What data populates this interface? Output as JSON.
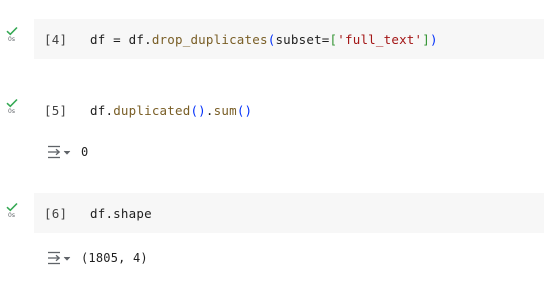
{
  "cells": [
    {
      "status": "0s",
      "exec_count": "[4]",
      "code": {
        "p1": "df = df.",
        "fn": "drop_duplicates",
        "p2": "(",
        "p3": "subset=",
        "p4": "[",
        "str": "'full_text'",
        "p5": "]",
        "p6": ")"
      }
    },
    {
      "status": "0s",
      "exec_count": "[5]",
      "code": {
        "p1": "df.",
        "fn": "duplicated",
        "p2": "()",
        "p3": ".",
        "fn2": "sum",
        "p4": "()"
      },
      "output": "0"
    },
    {
      "status": "0s",
      "exec_count": "[6]",
      "code": {
        "p1": "df.shape"
      },
      "output": "(1805, 4)"
    }
  ],
  "colors": {
    "check": "#34a853",
    "cell_bg": "#f7f7f7",
    "function": "#795e26",
    "string": "#a31515"
  }
}
